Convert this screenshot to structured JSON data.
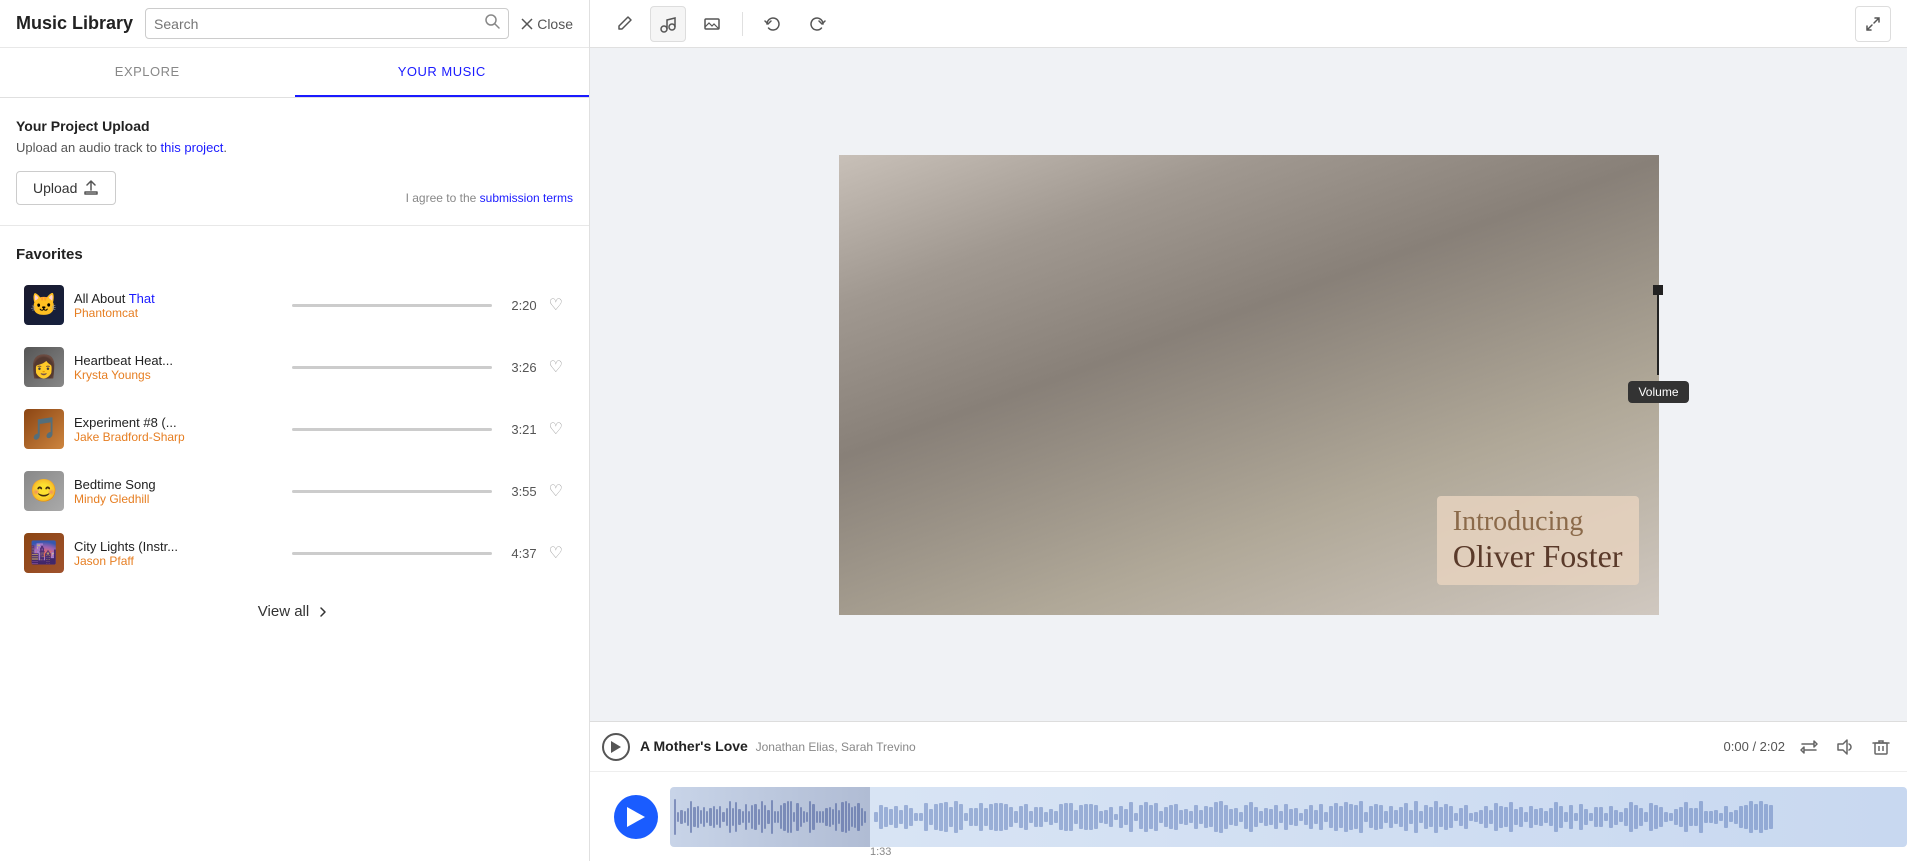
{
  "app": {
    "title": "Music Library"
  },
  "search": {
    "placeholder": "Search"
  },
  "close_button": "Close",
  "tabs": [
    {
      "id": "explore",
      "label": "EXPLORE",
      "active": false
    },
    {
      "id": "your-music",
      "label": "YOUR MUSIC",
      "active": true
    }
  ],
  "upload_section": {
    "title": "Your Project Upload",
    "subtitle": "Upload an audio track to this project.",
    "subtitle_link": "this project",
    "upload_button": "Upload",
    "terms_text": "I agree to the",
    "terms_link": "submission terms"
  },
  "favorites": {
    "title": "Favorites",
    "tracks": [
      {
        "name": "All About That",
        "artist": "Phantomcat",
        "duration": "2:20",
        "thumb_type": "cat"
      },
      {
        "name": "Heartbeat Heat...",
        "artist": "Krysta Youngs",
        "duration": "3:26",
        "thumb_type": "person"
      },
      {
        "name": "Experiment #8 (...",
        "artist": "Jake Bradford-Sharp",
        "duration": "3:21",
        "thumb_type": "exp"
      },
      {
        "name": "Bedtime Song",
        "artist": "Mindy Gledhill",
        "duration": "3:55",
        "thumb_type": "face"
      },
      {
        "name": "City Lights (Instr...",
        "artist": "Jason Pfaff",
        "duration": "4:37",
        "thumb_type": "city"
      }
    ]
  },
  "view_all": "View all",
  "toolbar": {
    "edit_icon": "✏️",
    "music_icon": "♫",
    "image_icon": "▭",
    "undo_icon": "↺",
    "redo_icon": "↻",
    "expand_icon": "⤢"
  },
  "overlay": {
    "line1": "Introducing",
    "line2": "Oliver Foster"
  },
  "timeline": {
    "play_icon": "▶",
    "track_name": "A Mother's Love",
    "track_artists": "Jonathan Elias, Sarah Trevino",
    "time_current": "0:00",
    "time_total": "2:02",
    "time_display": "0:00 / 2:02",
    "timestamp": "1:33",
    "volume_tooltip": "Volume"
  },
  "colors": {
    "accent_blue": "#1a5cff",
    "nav_active": "#1a1aff",
    "artist_orange": "#e67e22"
  }
}
